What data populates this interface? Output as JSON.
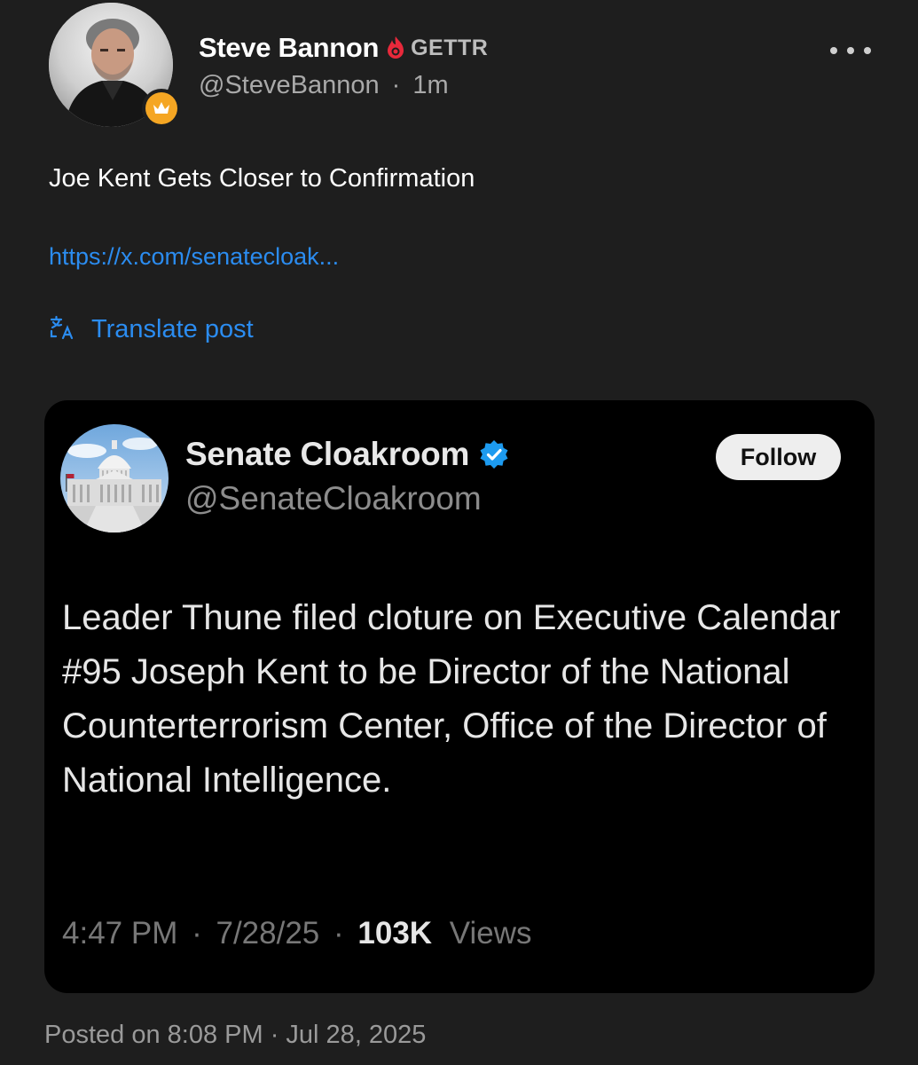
{
  "post": {
    "author_name": "Steve Bannon",
    "platform_label": "GETTR",
    "handle": "@SteveBannon",
    "separator": "·",
    "time_ago": "1m",
    "text": "Joe Kent Gets Closer to Confirmation",
    "link_text": "https://x.com/senatecloak...",
    "translate_label": "Translate post",
    "posted_on": "Posted on 8:08 PM · Jul 28, 2025"
  },
  "embed": {
    "name": "Senate Cloakroom",
    "handle": "@SenateCloakroom",
    "follow_label": "Follow",
    "text": "Leader Thune filed cloture on Executive Calendar #95 Joseph Kent to be Director of the National Counterterrorism Center, Office of the Director of National Intelligence.",
    "time": "4:47 PM",
    "date": "7/28/25",
    "views_count": "103K",
    "views_label": "Views",
    "dot": "·"
  },
  "icons": {
    "more": "more-horizontal-icon",
    "gettr": "gettr-flame-icon",
    "badge": "crown-badge-icon",
    "translate": "translate-icon",
    "verified": "verified-badge-icon"
  },
  "colors": {
    "background": "#1e1e1e",
    "card_background": "#000000",
    "link_blue": "#2b8cf0",
    "gettr_red": "#e8293b",
    "verified_blue": "#1d9bf0",
    "badge_orange": "#f5a623"
  }
}
